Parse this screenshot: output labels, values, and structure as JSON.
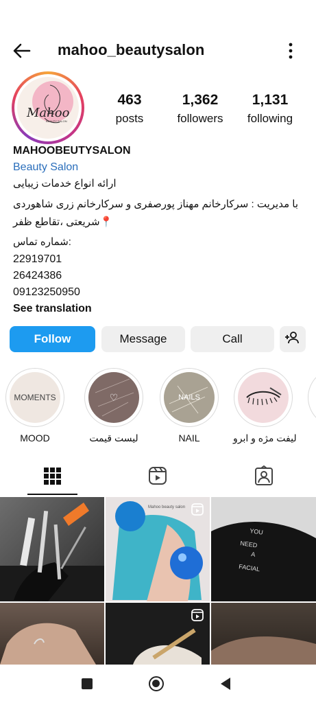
{
  "header": {
    "username": "mahoo_beautysalon",
    "back_icon": "arrow-left-icon",
    "more_icon": "more-vertical-icon"
  },
  "profile": {
    "avatar_text": "Mahoo",
    "avatar_subtext": "BEAUTY SALON",
    "stats": [
      {
        "value": "463",
        "label": "posts"
      },
      {
        "value": "1,362",
        "label": "followers"
      },
      {
        "value": "1,131",
        "label": "following"
      }
    ],
    "name": "MAHOOBEUTYSALON",
    "category": "Beauty Salon",
    "bio_lines": [
      "ارائه انواع خدمات زیبایی",
      "با مدیریت : سرکارخانم مهناز پورصفری و سرکارخانم زری شاهوردی",
      "📍شریعتی ،تقاطع ظفر",
      ":شماره تماس",
      "22919701",
      "26424386",
      "09123250950"
    ],
    "see_translation": "See translation"
  },
  "actions": {
    "follow": "Follow",
    "message": "Message",
    "call": "Call",
    "add_user_icon": "add-person-icon"
  },
  "highlights": [
    {
      "label": "MOOD",
      "image_text": "MOMENTS"
    },
    {
      "label": "لیست قیمت",
      "image_text": "♡"
    },
    {
      "label": "NAIL",
      "image_text": "NAILS"
    },
    {
      "label": "لیفت مژه و ابرو",
      "image_text": ""
    }
  ],
  "tabs": [
    {
      "name": "grid-icon",
      "active": true
    },
    {
      "name": "reels-icon",
      "active": false
    },
    {
      "name": "tagged-icon",
      "active": false
    }
  ],
  "posts": [
    {
      "id": "p1",
      "text": ""
    },
    {
      "id": "p2",
      "text": "Mahoo beauty salon",
      "reel": true
    },
    {
      "id": "p3",
      "text": "YOU NEED A FACIAL"
    },
    {
      "id": "p4",
      "text": ""
    },
    {
      "id": "p5",
      "text": "",
      "reel": true
    },
    {
      "id": "p6",
      "text": ""
    }
  ],
  "colors": {
    "follow_button": "#1d9bf0",
    "category_link": "#2a6ebb",
    "secondary_button": "#efefef"
  }
}
